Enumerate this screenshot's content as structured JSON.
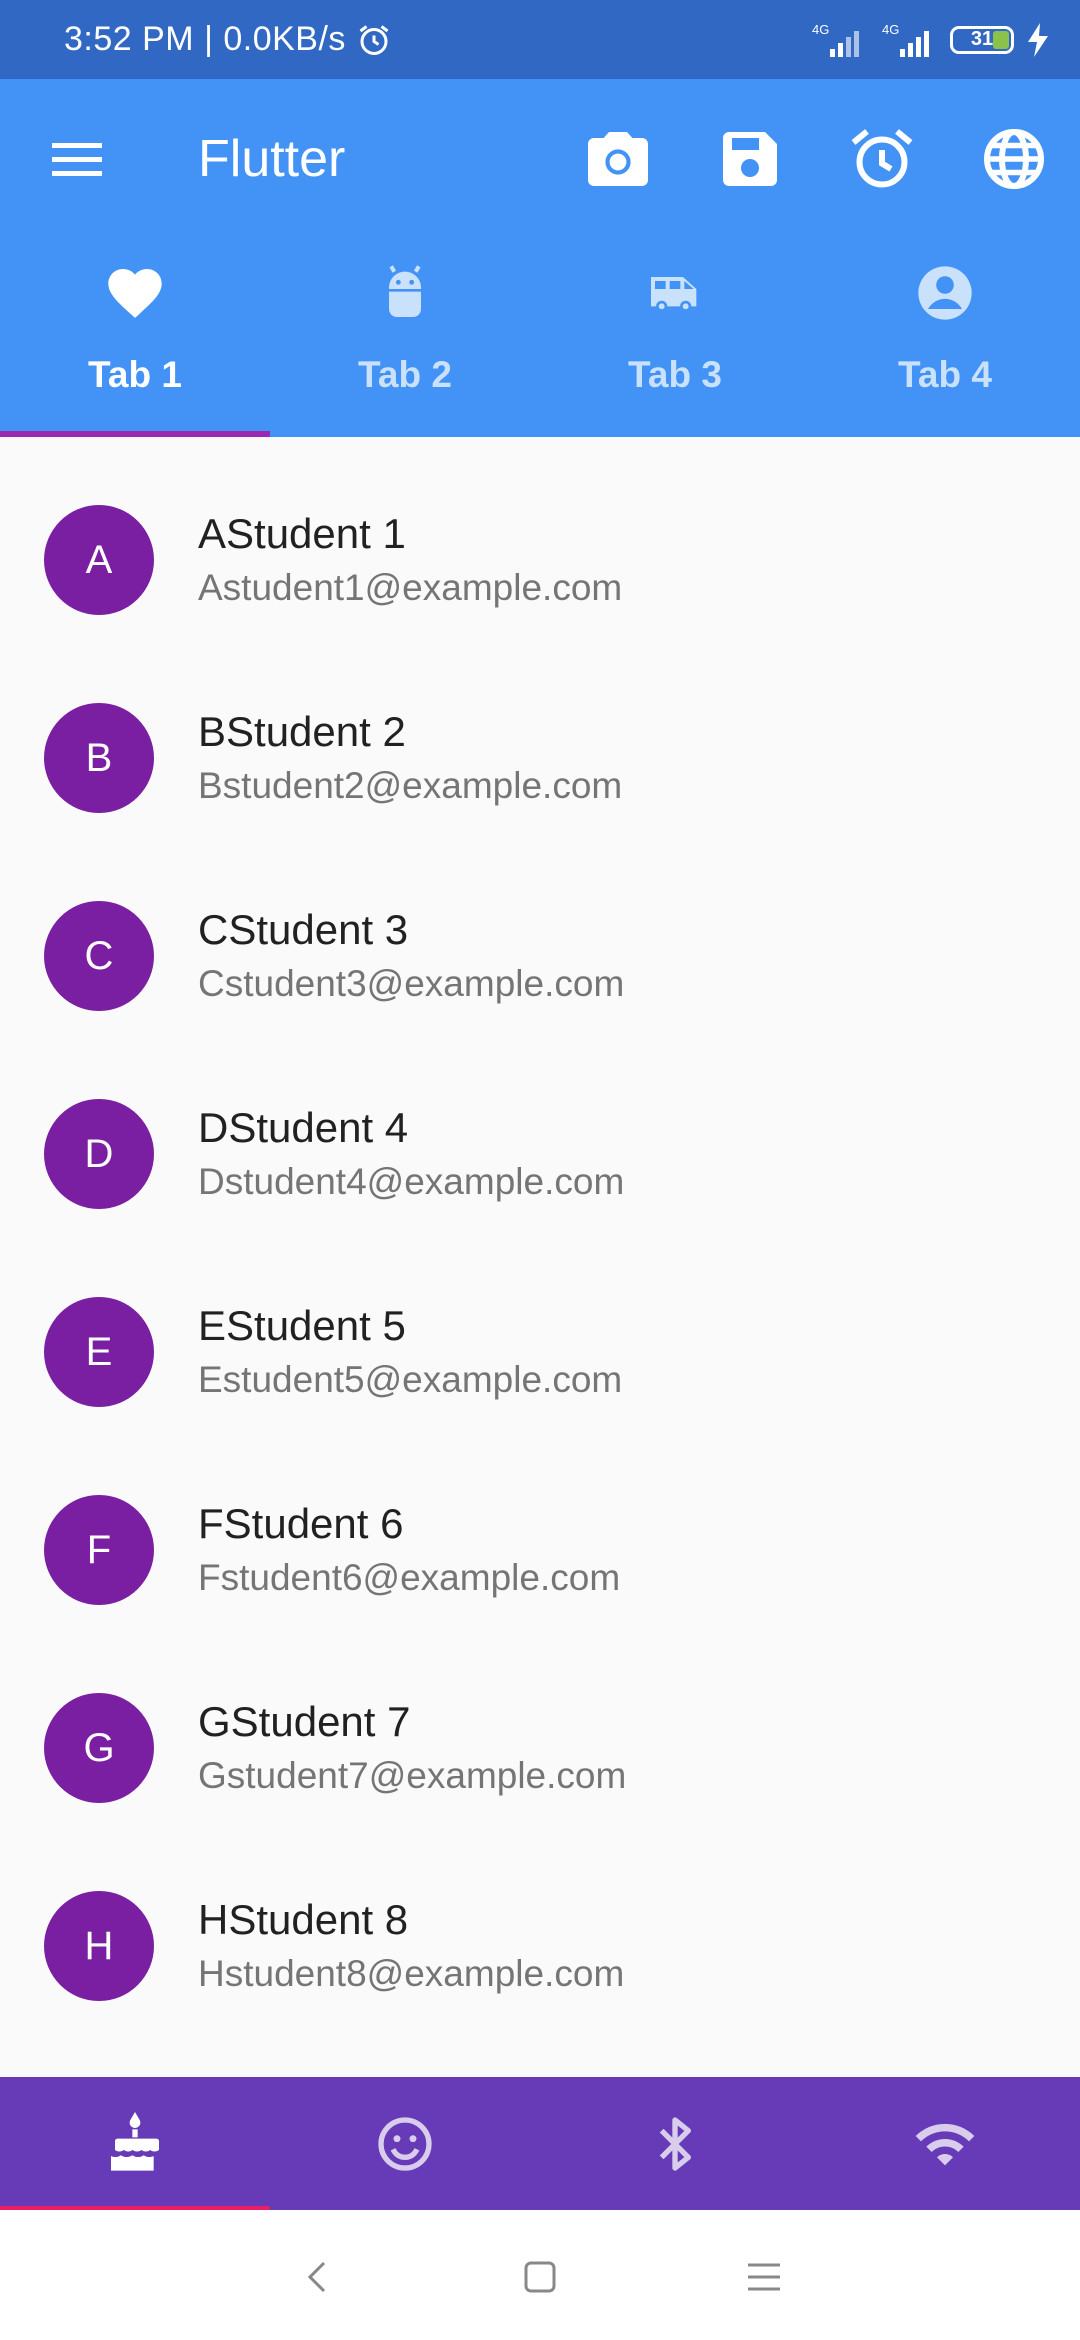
{
  "status_bar": {
    "time": "3:52 PM | 0.0KB/s",
    "network_1": "4G",
    "network_2": "4G",
    "battery": "31",
    "icons": [
      "alarm-icon",
      "signal-icon",
      "signal-icon",
      "battery-icon",
      "charging-icon"
    ]
  },
  "app_bar": {
    "title": "Flutter",
    "actions": [
      "camera-icon",
      "save-icon",
      "alarm-icon",
      "language-icon"
    ],
    "color": "#4293f5"
  },
  "tabs": [
    {
      "label": "Tab 1",
      "icon": "favorite-icon",
      "selected": true
    },
    {
      "label": "Tab 2",
      "icon": "android-icon",
      "selected": false
    },
    {
      "label": "Tab 3",
      "icon": "bus-icon",
      "selected": false
    },
    {
      "label": "Tab 4",
      "icon": "account-circle-icon",
      "selected": false
    }
  ],
  "students": [
    {
      "initial": "A",
      "name": "AStudent 1",
      "email": "Astudent1@example.com"
    },
    {
      "initial": "B",
      "name": "BStudent 2",
      "email": "Bstudent2@example.com"
    },
    {
      "initial": "C",
      "name": "CStudent 3",
      "email": "Cstudent3@example.com"
    },
    {
      "initial": "D",
      "name": "DStudent 4",
      "email": "Dstudent4@example.com"
    },
    {
      "initial": "E",
      "name": "EStudent 5",
      "email": "Estudent5@example.com"
    },
    {
      "initial": "F",
      "name": "FStudent 6",
      "email": "Fstudent6@example.com"
    },
    {
      "initial": "G",
      "name": "GStudent 7",
      "email": "Gstudent7@example.com"
    },
    {
      "initial": "H",
      "name": "HStudent 8",
      "email": "Hstudent8@example.com"
    }
  ],
  "bottom_nav": {
    "items": [
      "cake-icon",
      "smiley-icon",
      "bluetooth-icon",
      "wifi-icon"
    ],
    "selected_index": 0,
    "color": "#673ab7"
  },
  "system_nav": [
    "back-icon",
    "home-icon",
    "recents-icon"
  ]
}
